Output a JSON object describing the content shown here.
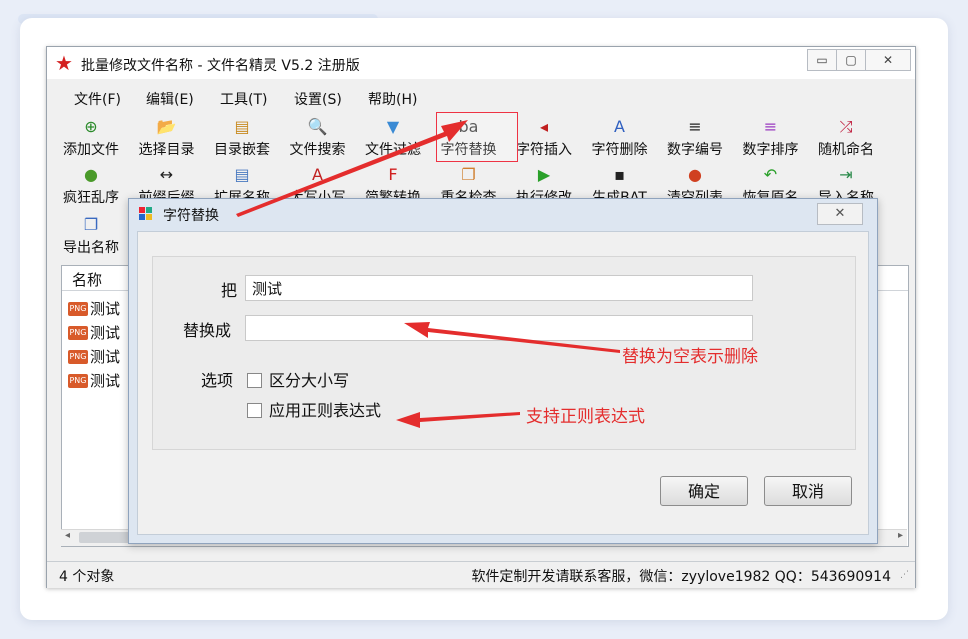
{
  "window": {
    "title": "批量修改文件名称 - 文件名精灵 V5.2 注册版",
    "min": "▭",
    "restore": "▢",
    "close": "✕"
  },
  "menu": [
    "文件(F)",
    "编辑(E)",
    "工具(T)",
    "设置(S)",
    "帮助(H)"
  ],
  "toolbar_row1": [
    {
      "label": "添加文件",
      "icon": "add-file-icon",
      "glyph": "⊕",
      "color": "#2a8a2a"
    },
    {
      "label": "选择目录",
      "icon": "folder-icon",
      "glyph": "📂",
      "color": "#d4a020"
    },
    {
      "label": "目录嵌套",
      "icon": "nested-folder-icon",
      "glyph": "▤",
      "color": "#c88a20"
    },
    {
      "label": "文件搜索",
      "icon": "search-icon",
      "glyph": "🔍",
      "color": "#3b6fc4"
    },
    {
      "label": "文件过滤",
      "icon": "filter-icon",
      "glyph": "▼",
      "color": "#3a8ad4"
    },
    {
      "label": "字符替换",
      "icon": "replace-chars-icon",
      "glyph": "ba",
      "color": "#333"
    },
    {
      "label": "字符插入",
      "icon": "insert-chars-icon",
      "glyph": "◂",
      "color": "#c02020"
    },
    {
      "label": "字符删除",
      "icon": "delete-chars-icon",
      "glyph": "A",
      "color": "#3060c0"
    },
    {
      "label": "数字编号",
      "icon": "numbering-icon",
      "glyph": "≡",
      "color": "#222"
    },
    {
      "label": "数字排序",
      "icon": "sort-icon",
      "glyph": "≡",
      "color": "#9a3ac0"
    },
    {
      "label": "随机命名",
      "icon": "shuffle-icon",
      "glyph": "⤮",
      "color": "#c02040"
    }
  ],
  "toolbar_row2": [
    {
      "label": "疯狂乱序",
      "icon": "frog-icon",
      "glyph": "●",
      "color": "#4a9a2a"
    },
    {
      "label": "前缀后缀",
      "icon": "arrows-icon",
      "glyph": "↔",
      "color": "#222"
    },
    {
      "label": "扩展名称",
      "icon": "extension-icon",
      "glyph": "▤",
      "color": "#4a7ac0"
    },
    {
      "label": "大写小写",
      "icon": "case-icon",
      "glyph": "A",
      "color": "#c02020"
    },
    {
      "label": "简繁转换",
      "icon": "convert-icon",
      "glyph": "F",
      "color": "#d02020"
    },
    {
      "label": "重名检查",
      "icon": "duplicate-icon",
      "glyph": "❐",
      "color": "#d08030"
    },
    {
      "label": "执行修改",
      "icon": "play-icon",
      "glyph": "▶",
      "color": "#2aa02a"
    },
    {
      "label": "生成BAT",
      "icon": "console-icon",
      "glyph": "▪",
      "color": "#222"
    },
    {
      "label": "清空列表",
      "icon": "clear-icon",
      "glyph": "●",
      "color": "#d04020"
    },
    {
      "label": "恢复原名",
      "icon": "undo-icon",
      "glyph": "↶",
      "color": "#2aa02a"
    },
    {
      "label": "导入名称",
      "icon": "import-icon",
      "glyph": "⇥",
      "color": "#2a8a4a"
    }
  ],
  "toolbar_row3": [
    {
      "label": "导出名称",
      "icon": "export-icon",
      "glyph": "❐",
      "color": "#3a6ac0"
    }
  ],
  "list": {
    "header": "名称",
    "rows": [
      "测试",
      "测试",
      "测试",
      "测试"
    ],
    "file_badge": "PNG"
  },
  "status": {
    "count": "4 个对象",
    "contact": "软件定制开发请联系客服，微信：zyylove1982  QQ：543690914"
  },
  "dialog": {
    "title": "字符替换",
    "find_label": "把",
    "find_value": "测试",
    "replace_label": "替换成",
    "replace_value": "",
    "options_label": "选项",
    "option_case": "区分大小写",
    "option_regex": "应用正则表达式",
    "ok": "确定",
    "cancel": "取消",
    "close": "✕"
  },
  "annotations": {
    "replace_note": "替换为空表示删除",
    "regex_note": "支持正则表达式"
  },
  "colors": {
    "accent": "#e42d2d"
  }
}
